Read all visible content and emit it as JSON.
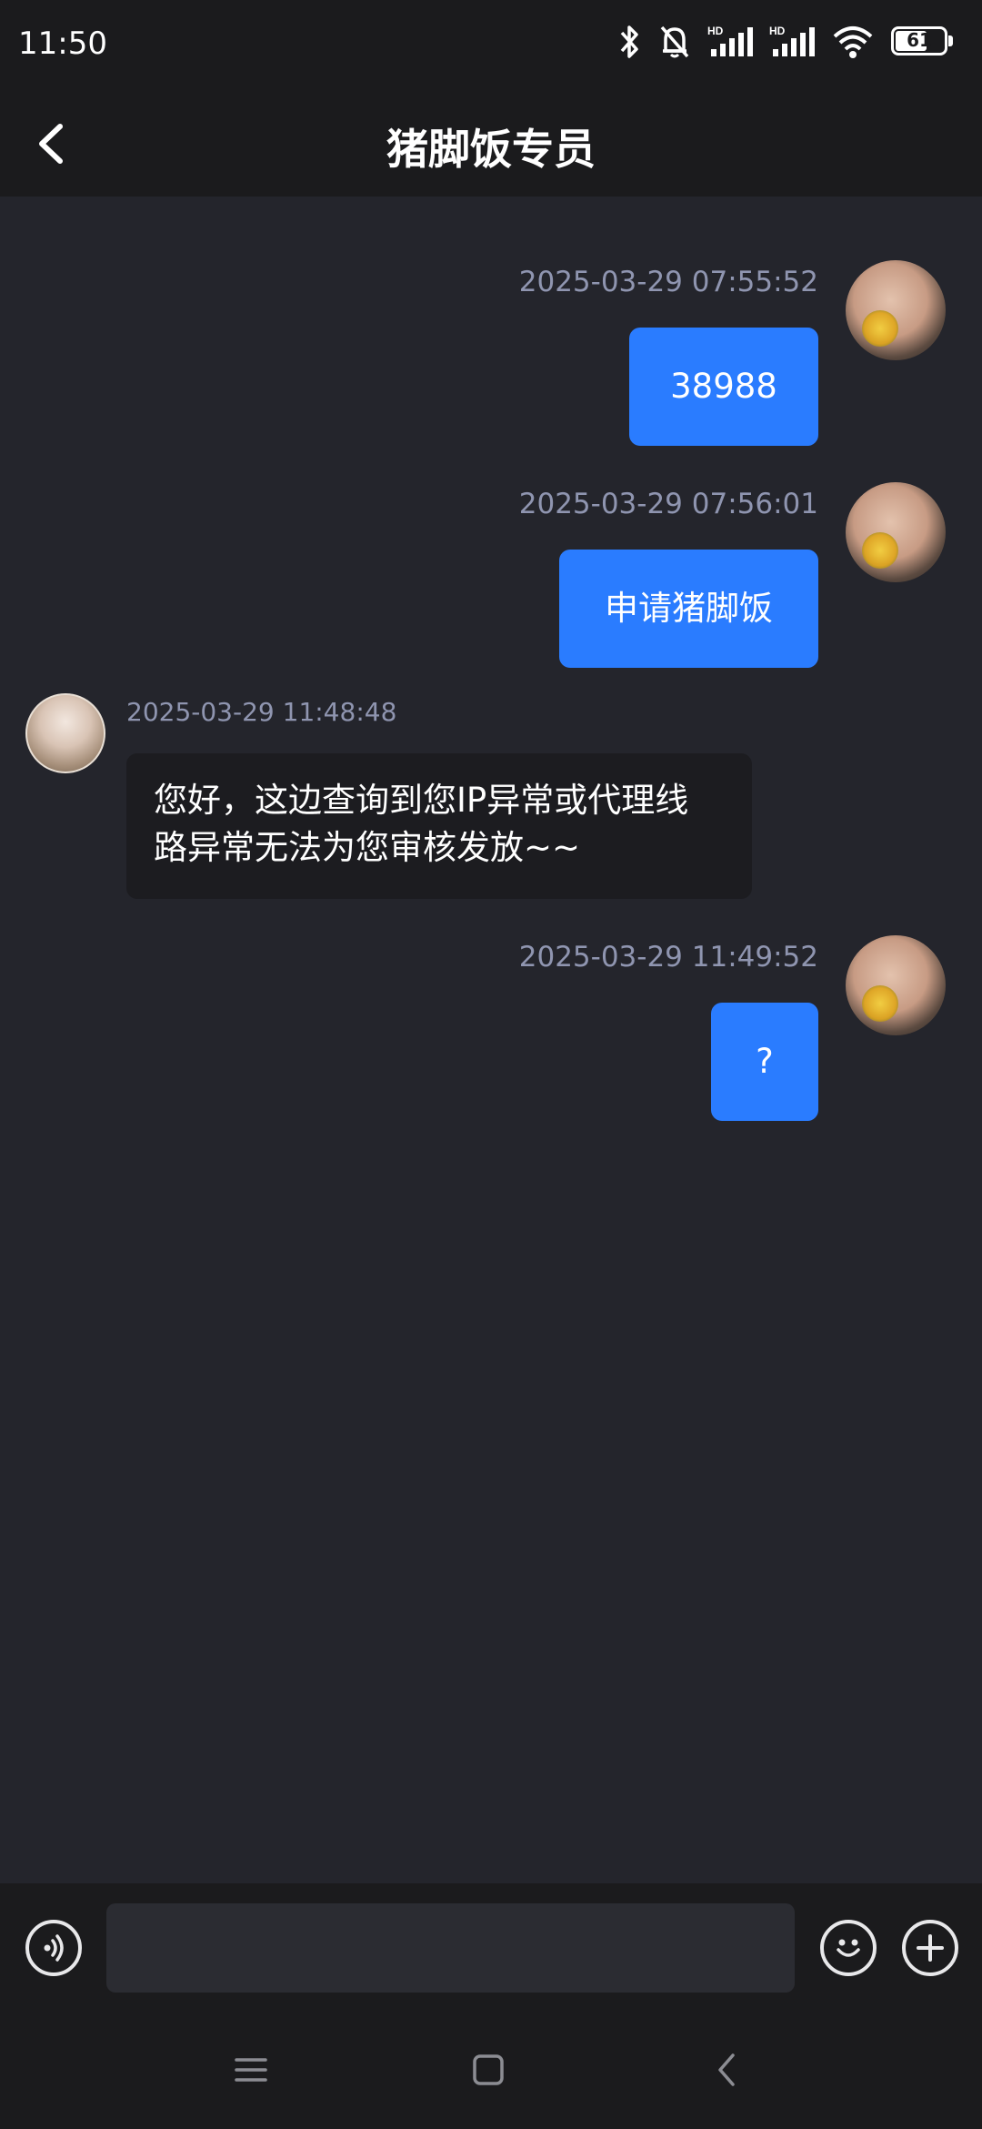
{
  "status_bar": {
    "time": "11:50",
    "battery": "61",
    "icons": [
      "bluetooth-icon",
      "bell-off-icon",
      "signal-hd-icon",
      "signal-hd-icon",
      "wifi-icon",
      "battery-icon"
    ]
  },
  "header": {
    "title": "猪脚饭专员",
    "back_icon": "chevron-left-icon"
  },
  "messages": [
    {
      "sender": "me",
      "timestamp": "2025-03-29 07:55:52",
      "text": "38988"
    },
    {
      "sender": "me",
      "timestamp": "2025-03-29 07:56:01",
      "text": "申请猪脚饭"
    },
    {
      "sender": "agent",
      "timestamp": "2025-03-29 11:48:48",
      "lines": [
        "您好，这边查询到您IP异常或代理线",
        "路异常无法为您审核发放~~"
      ]
    },
    {
      "sender": "me",
      "timestamp": "2025-03-29 11:49:52",
      "text": "?"
    }
  ],
  "input_bar": {
    "voice_icon": "voice-icon",
    "placeholder": "",
    "emoji_icon": "emoji-icon",
    "plus_icon": "plus-icon"
  },
  "nav_bar": {
    "icons": [
      "menu-icon",
      "home-icon",
      "back-icon"
    ]
  },
  "colors": {
    "background": "#24252c",
    "bar": "#1b1b1d",
    "sent_bubble": "#2a7cff",
    "received_bubble": "#1c1c20",
    "timestamp": "#8f95b0"
  }
}
